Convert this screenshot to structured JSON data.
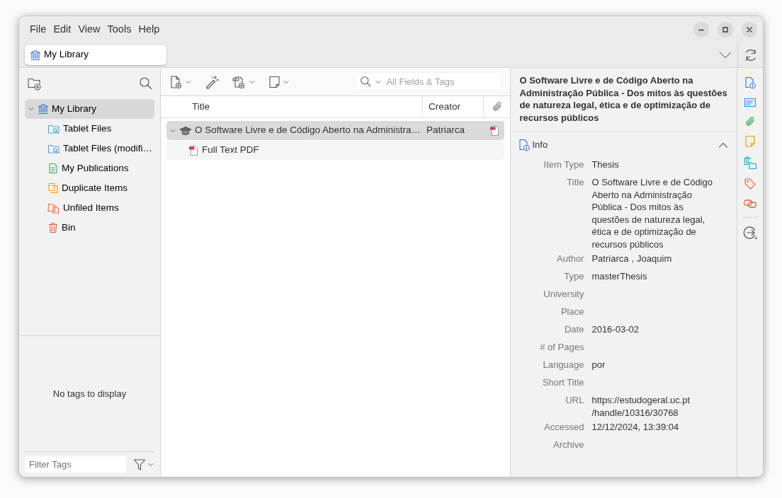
{
  "menu": [
    "File",
    "Edit",
    "View",
    "Tools",
    "Help"
  ],
  "tabs": [
    {
      "label": "My Library",
      "selected": true
    }
  ],
  "collections": [
    {
      "label": "My Library",
      "kind": "library",
      "expanded": true,
      "selected": true,
      "children": [
        {
          "label": "Tablet Files",
          "kind": "saved-search",
          "selected": false
        },
        {
          "label": "Tablet Files (modifi…",
          "kind": "saved-search",
          "selected": false
        },
        {
          "label": "My Publications",
          "kind": "publications",
          "selected": false
        },
        {
          "label": "Duplicate Items",
          "kind": "duplicates",
          "selected": false
        },
        {
          "label": "Unfiled Items",
          "kind": "unfiled",
          "selected": false
        },
        {
          "label": "Bin",
          "kind": "bin",
          "selected": false
        }
      ]
    }
  ],
  "tag_pane": {
    "empty_message": "No tags to display",
    "filter_placeholder": "Filter Tags"
  },
  "search": {
    "placeholder": "All Fields & Tags"
  },
  "items_table": {
    "columns": [
      "Title",
      "Creator"
    ],
    "rows": [
      {
        "title": "O Software Livre e de Código Aberto na Administra…",
        "creator": "Patriarca",
        "kind": "thesis",
        "expanded": true,
        "selected": true,
        "has_pdf": true,
        "children": [
          {
            "title": "Full Text PDF",
            "kind": "pdf",
            "selected": false
          }
        ]
      }
    ]
  },
  "item_pane": {
    "header": "O Software Livre e de Código Aberto na Administração Pública - Dos mitos às questões de natureza legal, ética e de optimização de recursos públicos",
    "section": {
      "title": "Info",
      "expanded": true
    },
    "fields": [
      {
        "label": "Item Type",
        "value": "Thesis"
      },
      {
        "label": "Title",
        "value": "O Software Livre e de Código Aberto na Administração Pública - Dos mitos às questões de natureza legal, ética e de optimização de recursos públicos"
      },
      {
        "label": "Author",
        "kind": "creator",
        "last": "Patriarca",
        "separator": ",",
        "first": "Joaquim"
      },
      {
        "label": "Type",
        "value": "masterThesis"
      },
      {
        "label": "University"
      },
      {
        "label": "Place"
      },
      {
        "label": "Date",
        "value": "2016-03-02"
      },
      {
        "label": "# of Pages"
      },
      {
        "label": "Language",
        "value": "por"
      },
      {
        "label": "Short Title"
      },
      {
        "label": "URL",
        "lines": [
          "https://estudogeral.uc.pt",
          "/handle/10316/30768"
        ]
      },
      {
        "label": "Accessed",
        "value": "12/12/2024, 13:39:04"
      },
      {
        "label": "Archive"
      }
    ]
  }
}
